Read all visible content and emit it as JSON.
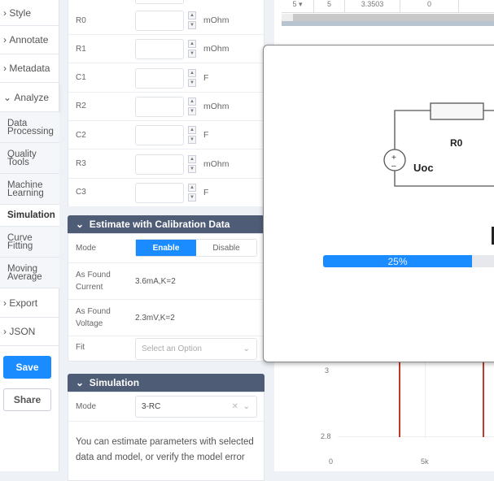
{
  "sidebar": {
    "items": [
      {
        "label": "Style"
      },
      {
        "label": "Annotate"
      },
      {
        "label": "Metadata"
      },
      {
        "label": "Analyze"
      }
    ],
    "subitems": [
      {
        "label": "Data Processing"
      },
      {
        "label": "Quality Tools"
      },
      {
        "label": "Machine Learning"
      },
      {
        "label": "Simulation"
      },
      {
        "label": "Curve Fitting"
      },
      {
        "label": "Moving Average"
      }
    ],
    "after": [
      {
        "label": "Export"
      },
      {
        "label": "JSON"
      }
    ],
    "save": "Save",
    "share": "Share"
  },
  "params": [
    {
      "name": "R0",
      "unit": "mOhm"
    },
    {
      "name": "R1",
      "unit": "mOhm"
    },
    {
      "name": "C1",
      "unit": "F"
    },
    {
      "name": "R2",
      "unit": "mOhm"
    },
    {
      "name": "C2",
      "unit": "F"
    },
    {
      "name": "R3",
      "unit": "mOhm"
    },
    {
      "name": "C3",
      "unit": "F"
    }
  ],
  "calib": {
    "title": "Estimate with Calibration Data",
    "mode_label": "Mode",
    "enable": "Enable",
    "disable": "Disable",
    "current_label": "As Found Current",
    "current_value": "3.6mA,K=2",
    "voltage_label": "As Found Voltage",
    "voltage_value": "2.3mV,K=2",
    "fit_label": "Fit",
    "fit_placeholder": "Select an Option"
  },
  "simulation": {
    "title": "Simulation",
    "mode_label": "Mode",
    "mode_value": "3-RC",
    "description": "You can estimate parameters with selected data and model, or verify the model error"
  },
  "table": {
    "row": [
      "5",
      "5",
      "3.3503",
      "0"
    ]
  },
  "modal": {
    "r0": "R0",
    "uoc": "Uoc",
    "progress_percent": 25,
    "progress_label": "25%"
  },
  "chart": {
    "y_ticks": [
      "3",
      "2.8"
    ],
    "x_ticks": [
      "0",
      "5k"
    ]
  },
  "colors": {
    "accent": "#1a8cff",
    "header": "#4e5d75",
    "line": "#c0392b"
  }
}
